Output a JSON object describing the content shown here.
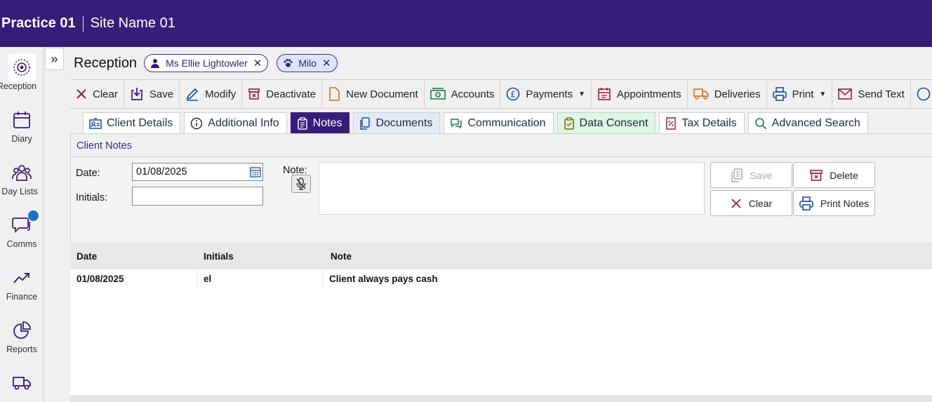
{
  "header": {
    "practice": "Practice 01",
    "site": "Site Name 01"
  },
  "rail": {
    "items": [
      {
        "label": "Reception",
        "icon": "reception-icon"
      },
      {
        "label": "Diary",
        "icon": "calendar-icon"
      },
      {
        "label": "Day Lists",
        "icon": "users-icon"
      },
      {
        "label": "Comms",
        "icon": "chat-icon"
      },
      {
        "label": "Finance",
        "icon": "trend-icon"
      },
      {
        "label": "Reports",
        "icon": "pie-chart-icon"
      },
      {
        "label": "",
        "icon": "truck-icon"
      }
    ]
  },
  "reception": {
    "title": "Reception",
    "client_chip": "Ms Ellie Lightowler",
    "pet_chip": "Milo"
  },
  "toolbar": {
    "clear": "Clear",
    "save": "Save",
    "modify": "Modify",
    "deactivate": "Deactivate",
    "new_document": "New Document",
    "accounts": "Accounts",
    "payments": "Payments",
    "appointments": "Appointments",
    "deliveries": "Deliveries",
    "print": "Print",
    "send_text": "Send Text"
  },
  "tabs": {
    "client_details": "Client Details",
    "additional_info": "Additional Info",
    "notes": "Notes",
    "documents": "Documents",
    "communication": "Communication",
    "data_consent": "Data Consent",
    "tax_details": "Tax Details",
    "advanced_search": "Advanced Search"
  },
  "notes_panel": {
    "title": "Client Notes",
    "date_label": "Date:",
    "date_value": "01/08/2025",
    "initials_label": "Initials:",
    "initials_value": "",
    "note_label": "Note:",
    "save": "Save",
    "delete": "Delete",
    "clear": "Clear",
    "print_notes": "Print Notes"
  },
  "grid": {
    "columns": [
      "Date",
      "Initials",
      "Note"
    ],
    "rows": [
      {
        "date": "01/08/2025",
        "initials": "el",
        "note": "Client always pays cash"
      }
    ]
  },
  "colors": {
    "brand": "#371d7a",
    "accent": "#1a73c9",
    "danger": "#8b1538"
  }
}
